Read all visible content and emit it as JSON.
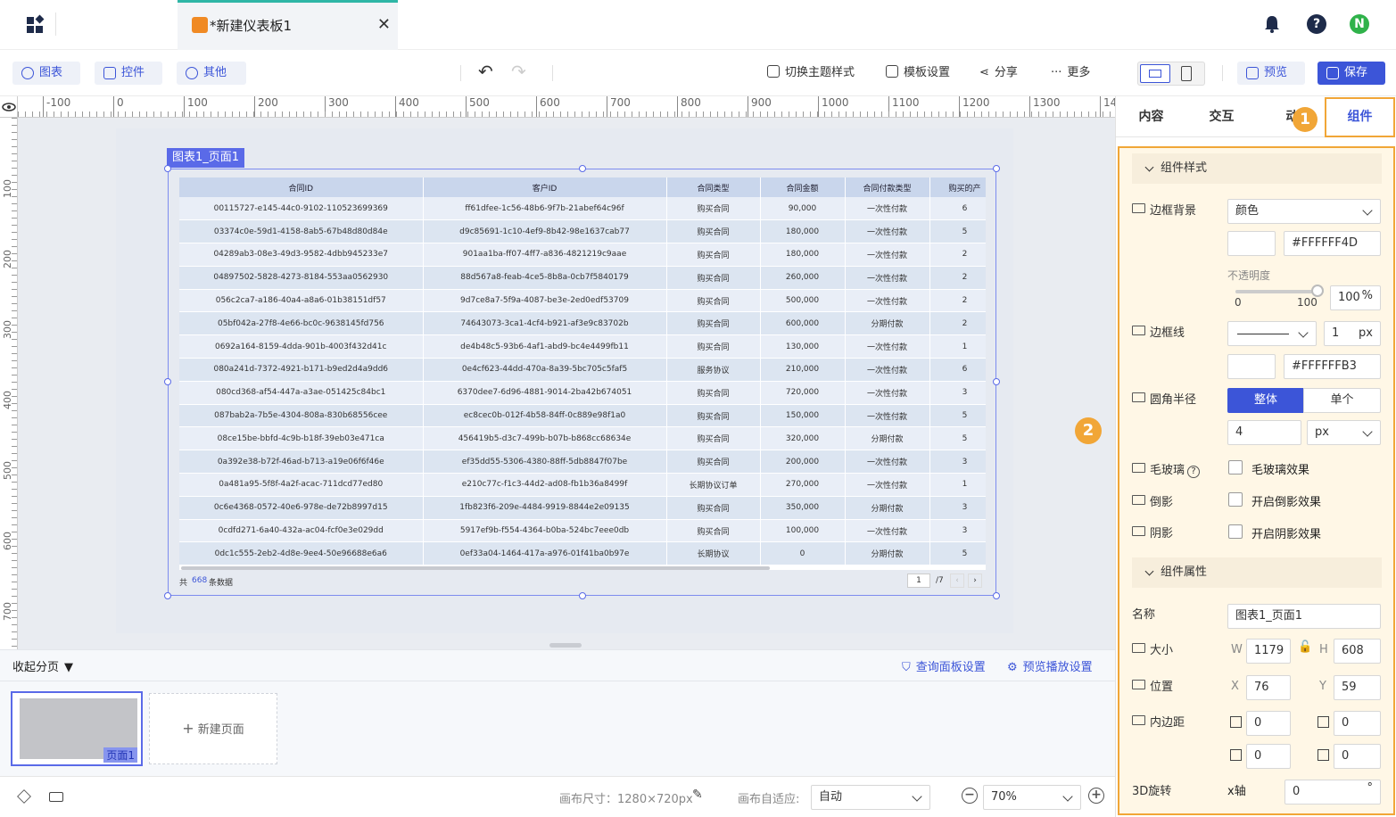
{
  "tab": {
    "title": "*新建仪表板1"
  },
  "header": {
    "avatar": "N"
  },
  "toolbar": {
    "chart": "图表",
    "control": "控件",
    "other": "其他",
    "theme": "切换主题样式",
    "template": "模板设置",
    "share": "分享",
    "more": "更多",
    "preview": "预览",
    "save": "保存"
  },
  "ruler": {
    "top": [
      "-100",
      "0",
      "100",
      "200",
      "300",
      "400",
      "500",
      "600",
      "700",
      "800",
      "900",
      "1000",
      "1100",
      "1200",
      "1300",
      "14"
    ],
    "left": [
      "100",
      "200",
      "300",
      "400",
      "500",
      "600",
      "700"
    ]
  },
  "selection": {
    "label": "图表1_页面1"
  },
  "table": {
    "columns": [
      "合同ID",
      "客户ID",
      "合同类型",
      "合同金额",
      "合同付款类型",
      "购买的产"
    ],
    "rows": [
      [
        "00115727-e145-44c0-9102-110523699369",
        "ff61dfee-1c56-48b6-9f7b-21abef64c96f",
        "购买合同",
        "90,000",
        "一次性付款",
        "6"
      ],
      [
        "03374c0e-59d1-4158-8ab5-67b48d80d84e",
        "d9c85691-1c10-4ef9-8b42-98e1637cab77",
        "购买合同",
        "180,000",
        "一次性付款",
        "5"
      ],
      [
        "04289ab3-08e3-49d3-9582-4dbb945233e7",
        "901aa1ba-ff07-4ff7-a836-4821219c9aae",
        "购买合同",
        "180,000",
        "一次性付款",
        "2"
      ],
      [
        "04897502-5828-4273-8184-553aa0562930",
        "88d567a8-feab-4ce5-8b8a-0cb7f5840179",
        "购买合同",
        "260,000",
        "一次性付款",
        "2"
      ],
      [
        "056c2ca7-a186-40a4-a8a6-01b38151df57",
        "9d7ce8a7-5f9a-4087-be3e-2ed0edf53709",
        "购买合同",
        "500,000",
        "一次性付款",
        "2"
      ],
      [
        "05bf042a-27f8-4e66-bc0c-9638145fd756",
        "74643073-3ca1-4cf4-b921-af3e9c83702b",
        "购买合同",
        "600,000",
        "分期付款",
        "2"
      ],
      [
        "0692a164-8159-4dda-901b-4003f432d41c",
        "de4b48c5-93b6-4af1-abd9-bc4e4499fb11",
        "购买合同",
        "130,000",
        "一次性付款",
        "1"
      ],
      [
        "080a241d-7372-4921-b171-b9ed2d4a9dd6",
        "0e4cf623-44dd-470a-8a39-5bc705c5faf5",
        "服务协议",
        "210,000",
        "一次性付款",
        "6"
      ],
      [
        "080cd368-af54-447a-a3ae-051425c84bc1",
        "6370dee7-6d96-4881-9014-2ba42b674051",
        "购买合同",
        "720,000",
        "一次性付款",
        "3"
      ],
      [
        "087bab2a-7b5e-4304-808a-830b68556cee",
        "ec8cec0b-012f-4b58-84ff-0c889e98f1a0",
        "购买合同",
        "150,000",
        "一次性付款",
        "5"
      ],
      [
        "08ce15be-bbfd-4c9b-b18f-39eb03e471ca",
        "456419b5-d3c7-499b-b07b-b868cc68634e",
        "购买合同",
        "320,000",
        "分期付款",
        "5"
      ],
      [
        "0a392e38-b72f-46ad-b713-a19e06f6f46e",
        "ef35dd55-5306-4380-88ff-5db8847f07be",
        "购买合同",
        "200,000",
        "一次性付款",
        "3"
      ],
      [
        "0a481a95-5f8f-4a2f-acac-711dcd77ed80",
        "e210c77c-f1c3-44d2-ad08-fb1b36a8499f",
        "长期协议订单",
        "270,000",
        "一次性付款",
        "1"
      ],
      [
        "0c6e4368-0572-40e6-978e-de72b8997d15",
        "1fb823f6-209e-4484-9919-8844e2e09135",
        "购买合同",
        "350,000",
        "分期付款",
        "3"
      ],
      [
        "0cdfd271-6a40-432a-ac04-fcf0e3e029dd",
        "5917ef9b-f554-4364-b0ba-524bc7eee0db",
        "购买合同",
        "100,000",
        "一次性付款",
        "3"
      ],
      [
        "0dc1c555-2eb2-4d8e-9ee4-50e96688e6a6",
        "0ef33a04-1464-417a-a976-01f41ba0b97e",
        "长期协议",
        "0",
        "分期付款",
        "5"
      ]
    ],
    "total_prefix": "共",
    "total_count": "668",
    "total_suffix": "条数据",
    "page": "1",
    "page_total": "/7"
  },
  "bottom": {
    "collapse": "收起分页",
    "query_settings": "查询面板设置",
    "preview_settings": "预览播放设置",
    "page1": "页面1",
    "new_page": "新建页面"
  },
  "status": {
    "canvas_size": "画布尺寸：1280×720px",
    "adapt_label": "画布自适应:",
    "adapt_value": "自动",
    "zoom": "70%"
  },
  "panel": {
    "tabs": [
      "内容",
      "交互",
      "动",
      "组件"
    ],
    "badge1": "1",
    "badge2": "2",
    "style_section": "组件样式",
    "border_bg": "边框背景",
    "bg_type": "颜色",
    "bg_color": "#FFFFFF4D",
    "opacity_label": "不透明度",
    "opacity_min": "0",
    "opacity_max": "100",
    "opacity_value": "100",
    "opacity_unit": "%",
    "opacity_fraction": 1,
    "border_line": "边框线",
    "border_width": "1",
    "border_unit": "px",
    "border_color": "#FFFFFFB3",
    "radius": "圆角半径",
    "radius_whole": "整体",
    "radius_single": "单个",
    "radius_value": "4",
    "radius_unit": "px",
    "frosted": "毛玻璃",
    "frosted_cb": "毛玻璃效果",
    "reflection": "倒影",
    "reflection_cb": "开启倒影效果",
    "shadow": "阴影",
    "shadow_cb": "开启阴影效果",
    "props_section": "组件属性",
    "name_label": "名称",
    "name_value": "图表1_页面1",
    "size_label": "大小",
    "w_label": "W",
    "w": "1179",
    "h_label": "H",
    "h": "608",
    "pos_label": "位置",
    "x_label": "X",
    "x": "76",
    "y_label": "Y",
    "y": "59",
    "padding_label": "内边距",
    "pad_top": "0",
    "pad_bottom": "0",
    "pad_left": "0",
    "pad_right": "0",
    "rotate_label": "3D旋转",
    "xaxis": "x轴",
    "xaxis_value": "0",
    "deg": "°"
  }
}
